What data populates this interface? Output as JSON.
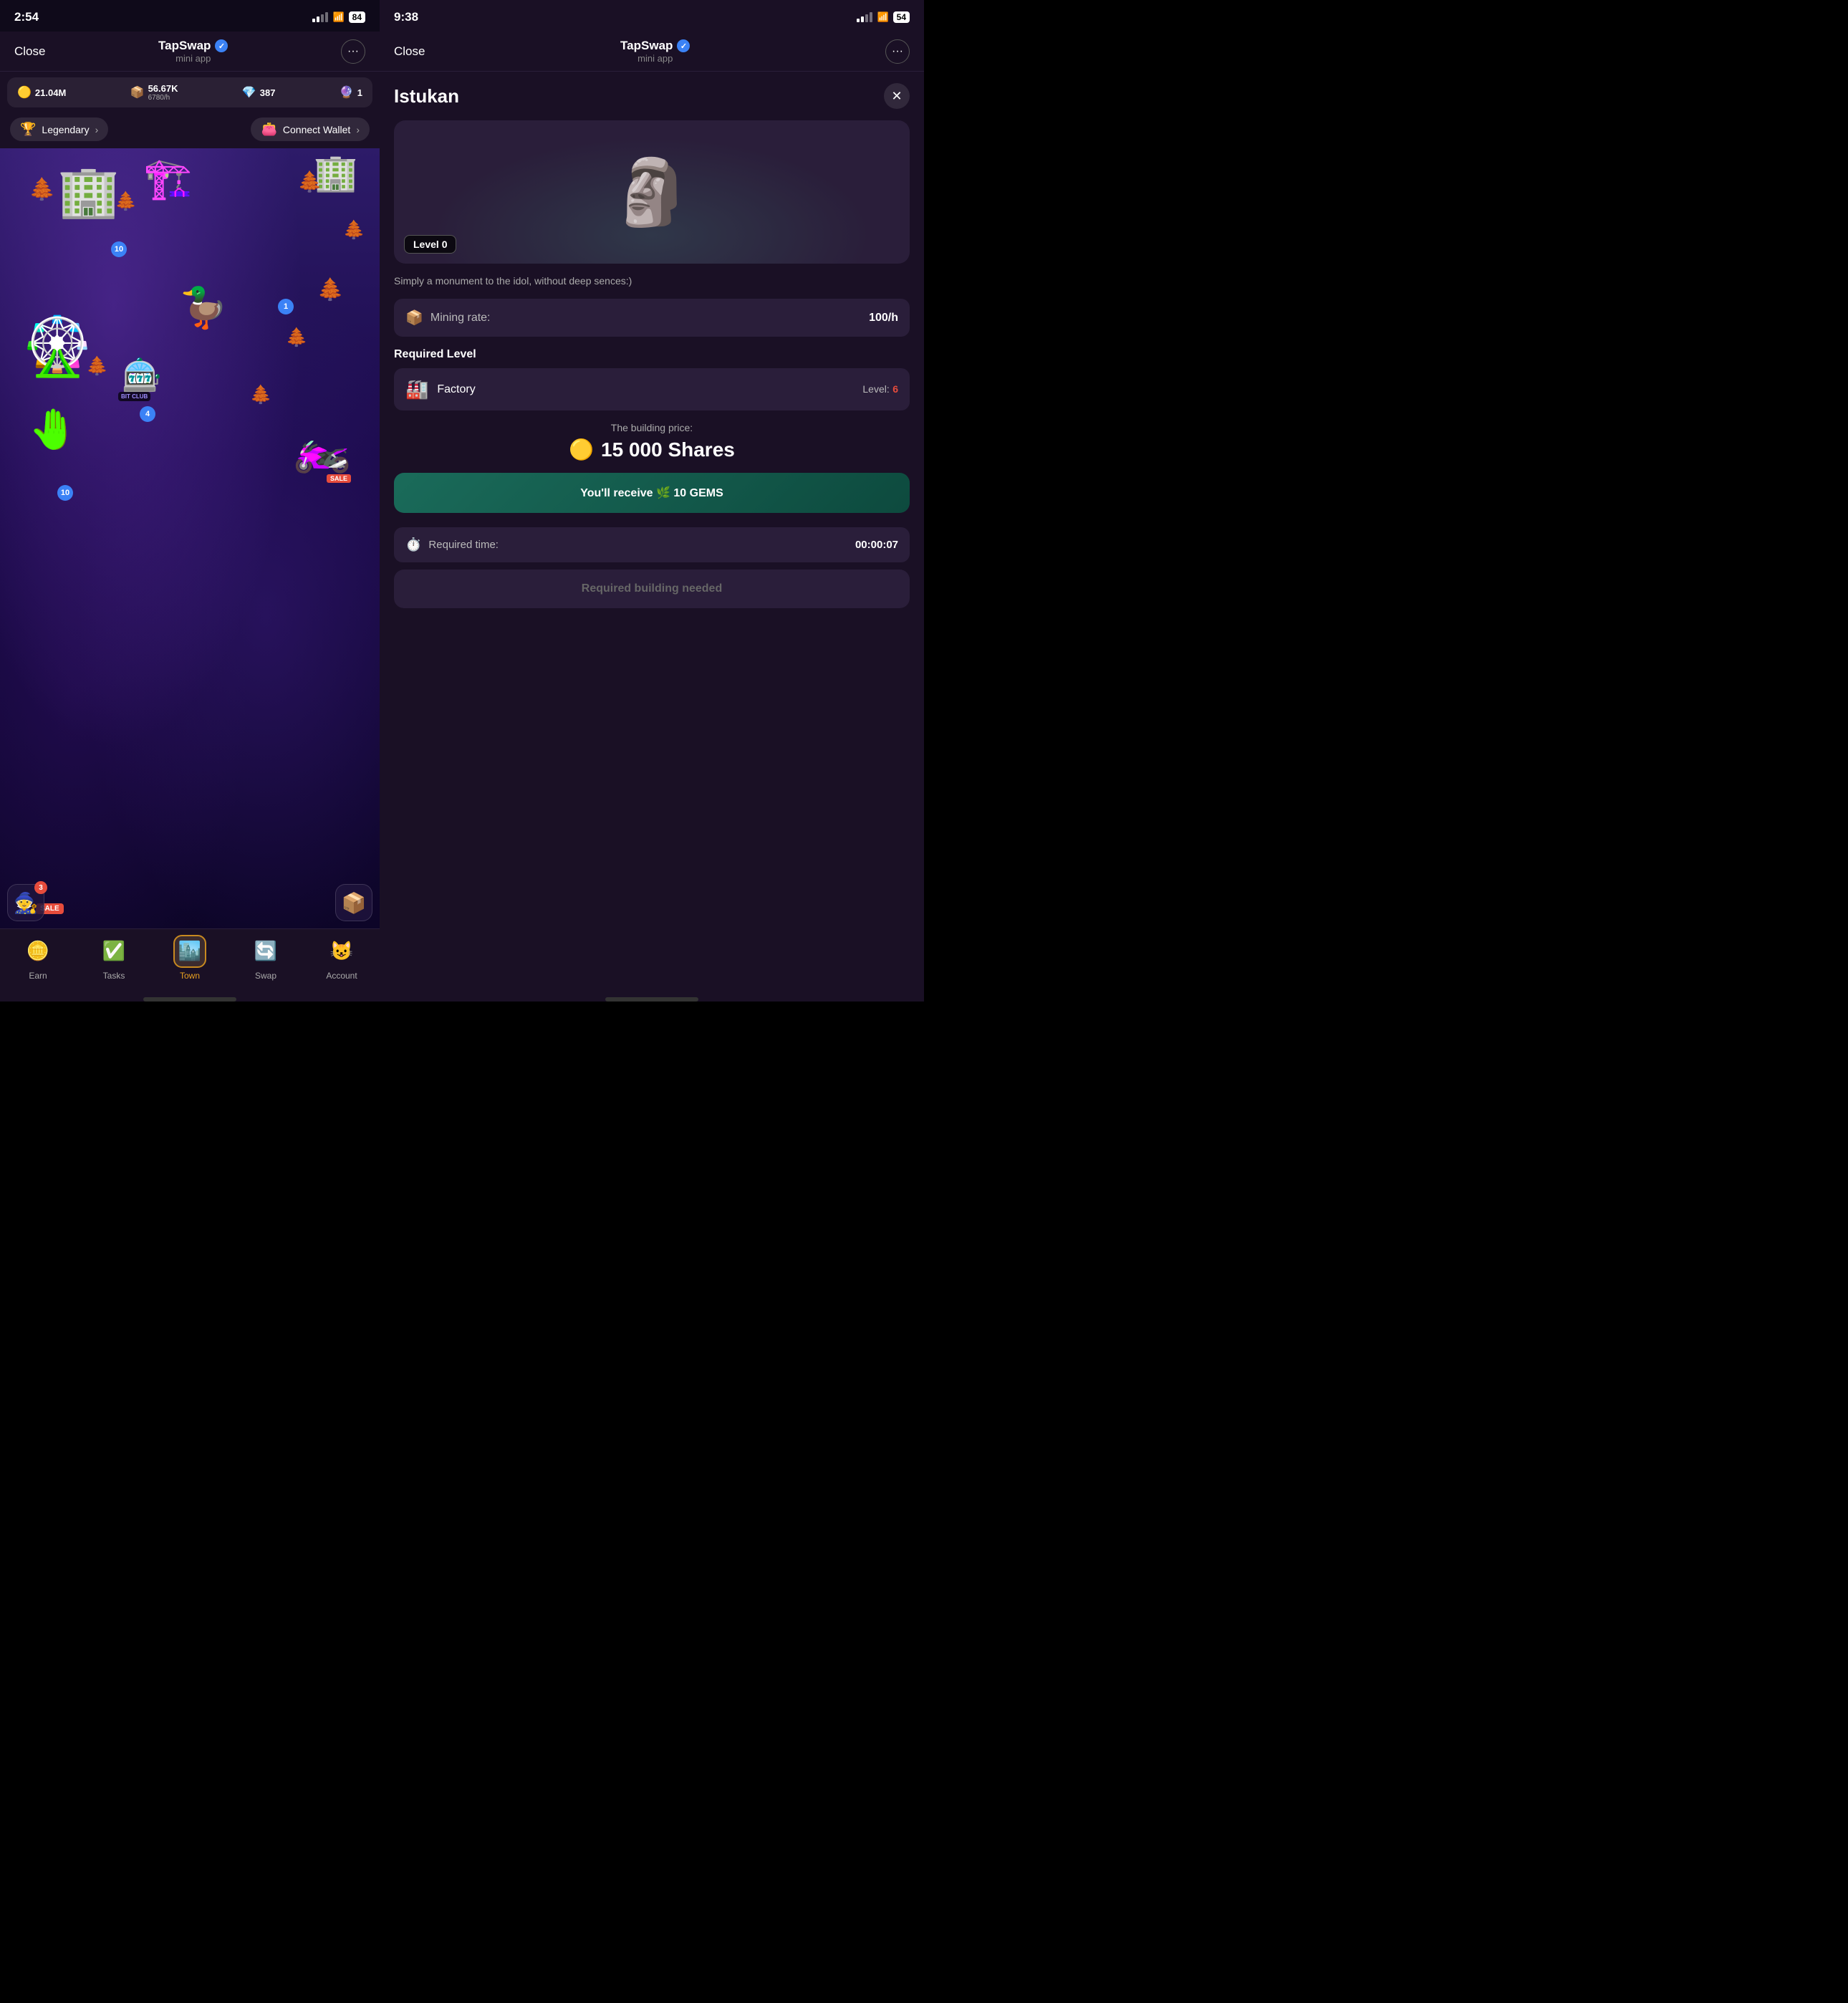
{
  "leftPanel": {
    "statusBar": {
      "time": "2:54",
      "battery": "84",
      "signal": true,
      "wifi": true
    },
    "header": {
      "close": "Close",
      "title": "TapSwap",
      "subtitle": "mini app",
      "verified": true
    },
    "stats": {
      "coins": "21.04M",
      "boxes": "56.67K",
      "boxRate": "6780/h",
      "gems": "387",
      "orbs": "1"
    },
    "actions": {
      "legendary": "Legendary",
      "connectWallet": "Connect Wallet"
    },
    "badges": {
      "badge10a": "10",
      "badge1": "1",
      "badge4": "4",
      "badge10b": "10"
    },
    "nav": {
      "items": [
        {
          "id": "earn",
          "label": "Earn",
          "icon": "🪙",
          "active": false
        },
        {
          "id": "tasks",
          "label": "Tasks",
          "icon": "✅",
          "active": false
        },
        {
          "id": "town",
          "label": "Town",
          "icon": "🏙️",
          "active": true
        },
        {
          "id": "swap",
          "label": "Swap",
          "icon": "🔄",
          "active": false
        },
        {
          "id": "account",
          "label": "Account",
          "icon": "😺",
          "active": false
        }
      ]
    }
  },
  "rightPanel": {
    "statusBar": {
      "time": "9:38",
      "battery": "54",
      "signal": true,
      "wifi": true
    },
    "header": {
      "close": "Close",
      "title": "TapSwap",
      "subtitle": "mini app",
      "verified": true
    },
    "modal": {
      "title": "Istukan",
      "closeIcon": "✕",
      "levelBadge": "Level 0",
      "description": "Simply a monument to the idol, without deep sences:)",
      "miningLabel": "Mining rate:",
      "miningValue": "100/h",
      "requiredLevelTitle": "Required Level",
      "factory": {
        "name": "Factory",
        "levelLabel": "Level:",
        "levelValue": "6"
      },
      "priceLabel": "The building price:",
      "priceValue": "15 000 Shares",
      "ctaLabel": "You'll receive 🌿 10 GEMS",
      "timeLabel": "Required time:",
      "timeValue": "00:00:07",
      "disabledBtn": "Required building needed"
    }
  }
}
